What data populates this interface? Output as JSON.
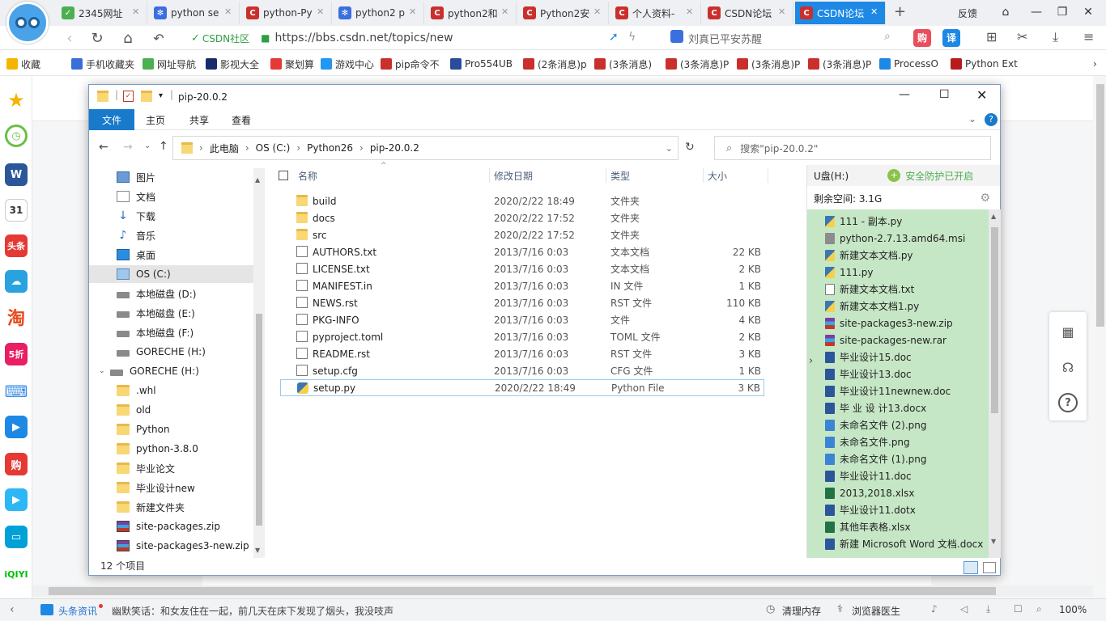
{
  "browser": {
    "tabs": [
      {
        "label": "2345网址",
        "icon": "2345-icon"
      },
      {
        "label": "python se",
        "icon": "baidu-icon"
      },
      {
        "label": "python-Py",
        "icon": "csdn-icon"
      },
      {
        "label": "python2 p",
        "icon": "baidu-icon"
      },
      {
        "label": "python2和",
        "icon": "csdn-icon"
      },
      {
        "label": "Python2安",
        "icon": "csdn-icon"
      },
      {
        "label": "个人资料-",
        "icon": "csdn-icon"
      },
      {
        "label": "CSDN论坛",
        "icon": "csdn-icon"
      },
      {
        "label": "CSDN论坛",
        "icon": "csdn-icon",
        "active": true
      }
    ],
    "new_tab": "+",
    "feedback": "反馈",
    "address": {
      "site_badge": "CSDN社区",
      "url": "https://bbs.csdn.net/topics/new",
      "search_text": "刘真已平安苏醒"
    },
    "bookmarks": [
      "收藏",
      "手机收藏夹",
      "网址导航",
      "影视大全",
      "聚划算",
      "游戏中心",
      "pip命令不",
      "Pro554UB",
      "(2条消息)p",
      "(3条消息)",
      "(3条消息)P",
      "(3条消息)P",
      "(3条消息)P",
      "ProcessO",
      "Python Ext"
    ],
    "status": {
      "news_label": "头条资讯",
      "news_text": "幽默笑话：和女友住在一起，前几天在床下发现了烟头，我没吱声",
      "clean_memory": "清理内存",
      "doctor": "浏览器医生",
      "zoom": "100%"
    }
  },
  "explorer": {
    "title": "pip-20.0.2",
    "ribbon_tabs": [
      "文件",
      "主页",
      "共享",
      "查看"
    ],
    "breadcrumb": [
      "此电脑",
      "OS (C:)",
      "Python26",
      "pip-20.0.2"
    ],
    "search_placeholder": "搜索\"pip-20.0.2\"",
    "tree": [
      {
        "label": "图片",
        "icon": "image-icon"
      },
      {
        "label": "文档",
        "icon": "document-icon"
      },
      {
        "label": "下载",
        "icon": "download-icon"
      },
      {
        "label": "音乐",
        "icon": "music-icon"
      },
      {
        "label": "桌面",
        "icon": "desktop-icon"
      },
      {
        "label": "OS (C:)",
        "icon": "os-drive-icon",
        "selected": true
      },
      {
        "label": "本地磁盘 (D:)",
        "icon": "drive-icon"
      },
      {
        "label": "本地磁盘 (E:)",
        "icon": "drive-icon"
      },
      {
        "label": "本地磁盘 (F:)",
        "icon": "drive-icon"
      },
      {
        "label": "GORECHE (H:)",
        "icon": "drive-icon"
      },
      {
        "label": "GORECHE (H:)",
        "icon": "drive-icon"
      },
      {
        "label": ".whl",
        "icon": "folder-icon"
      },
      {
        "label": "old",
        "icon": "folder-icon"
      },
      {
        "label": "Python",
        "icon": "folder-icon"
      },
      {
        "label": "python-3.8.0",
        "icon": "folder-icon"
      },
      {
        "label": "毕业论文",
        "icon": "folder-icon"
      },
      {
        "label": "毕业设计new",
        "icon": "folder-icon"
      },
      {
        "label": "新建文件夹",
        "icon": "folder-icon"
      },
      {
        "label": "site-packages.zip",
        "icon": "zip-icon"
      },
      {
        "label": "site-packages3-new.zip",
        "icon": "zip-icon"
      }
    ],
    "columns": [
      "名称",
      "修改日期",
      "类型",
      "大小"
    ],
    "files": [
      {
        "name": "build",
        "date": "2020/2/22 18:49",
        "type": "文件夹",
        "size": "",
        "kind": "folder"
      },
      {
        "name": "docs",
        "date": "2020/2/22 17:52",
        "type": "文件夹",
        "size": "",
        "kind": "folder"
      },
      {
        "name": "src",
        "date": "2020/2/22 17:52",
        "type": "文件夹",
        "size": "",
        "kind": "folder"
      },
      {
        "name": "AUTHORS.txt",
        "date": "2013/7/16 0:03",
        "type": "文本文档",
        "size": "22 KB",
        "kind": "txt"
      },
      {
        "name": "LICENSE.txt",
        "date": "2013/7/16 0:03",
        "type": "文本文档",
        "size": "2 KB",
        "kind": "txt"
      },
      {
        "name": "MANIFEST.in",
        "date": "2013/7/16 0:03",
        "type": "IN 文件",
        "size": "1 KB",
        "kind": "txt"
      },
      {
        "name": "NEWS.rst",
        "date": "2013/7/16 0:03",
        "type": "RST 文件",
        "size": "110 KB",
        "kind": "txt"
      },
      {
        "name": "PKG-INFO",
        "date": "2013/7/16 0:03",
        "type": "文件",
        "size": "4 KB",
        "kind": "txt"
      },
      {
        "name": "pyproject.toml",
        "date": "2013/7/16 0:03",
        "type": "TOML 文件",
        "size": "2 KB",
        "kind": "txt"
      },
      {
        "name": "README.rst",
        "date": "2013/7/16 0:03",
        "type": "RST 文件",
        "size": "3 KB",
        "kind": "txt"
      },
      {
        "name": "setup.cfg",
        "date": "2013/7/16 0:03",
        "type": "CFG 文件",
        "size": "1 KB",
        "kind": "txt"
      },
      {
        "name": "setup.py",
        "date": "2020/2/22 18:49",
        "type": "Python File",
        "size": "3 KB",
        "kind": "py",
        "selected": true
      }
    ],
    "item_count": "12 个项目",
    "upanel": {
      "drive": "U盘(H:)",
      "protect": "安全防护已开启",
      "free": "剩余空间: 3.1G",
      "items": [
        {
          "name": "111 - 副本.py",
          "kind": "pyf"
        },
        {
          "name": "python-2.7.13.amd64.msi",
          "kind": "msi"
        },
        {
          "name": "新建文本文档.py",
          "kind": "pyf"
        },
        {
          "name": "111.py",
          "kind": "pyf"
        },
        {
          "name": "新建文本文档.txt",
          "kind": "txtf"
        },
        {
          "name": "新建文本文档1.py",
          "kind": "pyf"
        },
        {
          "name": "site-packages3-new.zip",
          "kind": "rar"
        },
        {
          "name": "site-packages-new.rar",
          "kind": "rar"
        },
        {
          "name": "毕业设计15.doc",
          "kind": "word"
        },
        {
          "name": "毕业设计13.doc",
          "kind": "word"
        },
        {
          "name": "毕业设计11newnew.doc",
          "kind": "word"
        },
        {
          "name": "毕 业 设 计13.docx",
          "kind": "word"
        },
        {
          "name": "未命名文件 (2).png",
          "kind": "png"
        },
        {
          "name": "未命名文件.png",
          "kind": "png"
        },
        {
          "name": "未命名文件 (1).png",
          "kind": "png"
        },
        {
          "name": "毕业设计11.doc",
          "kind": "word"
        },
        {
          "name": "2013,2018.xlsx",
          "kind": "excel"
        },
        {
          "name": "毕业设计11.dotx",
          "kind": "word"
        },
        {
          "name": "其他年表格.xlsx",
          "kind": "excel"
        },
        {
          "name": "新建 Microsoft Word 文档.docx",
          "kind": "word"
        }
      ]
    }
  },
  "colors": {
    "accent": "#1979ca",
    "active_tab": "#1e88e5",
    "upanel_bg": "#c6e7c6"
  }
}
